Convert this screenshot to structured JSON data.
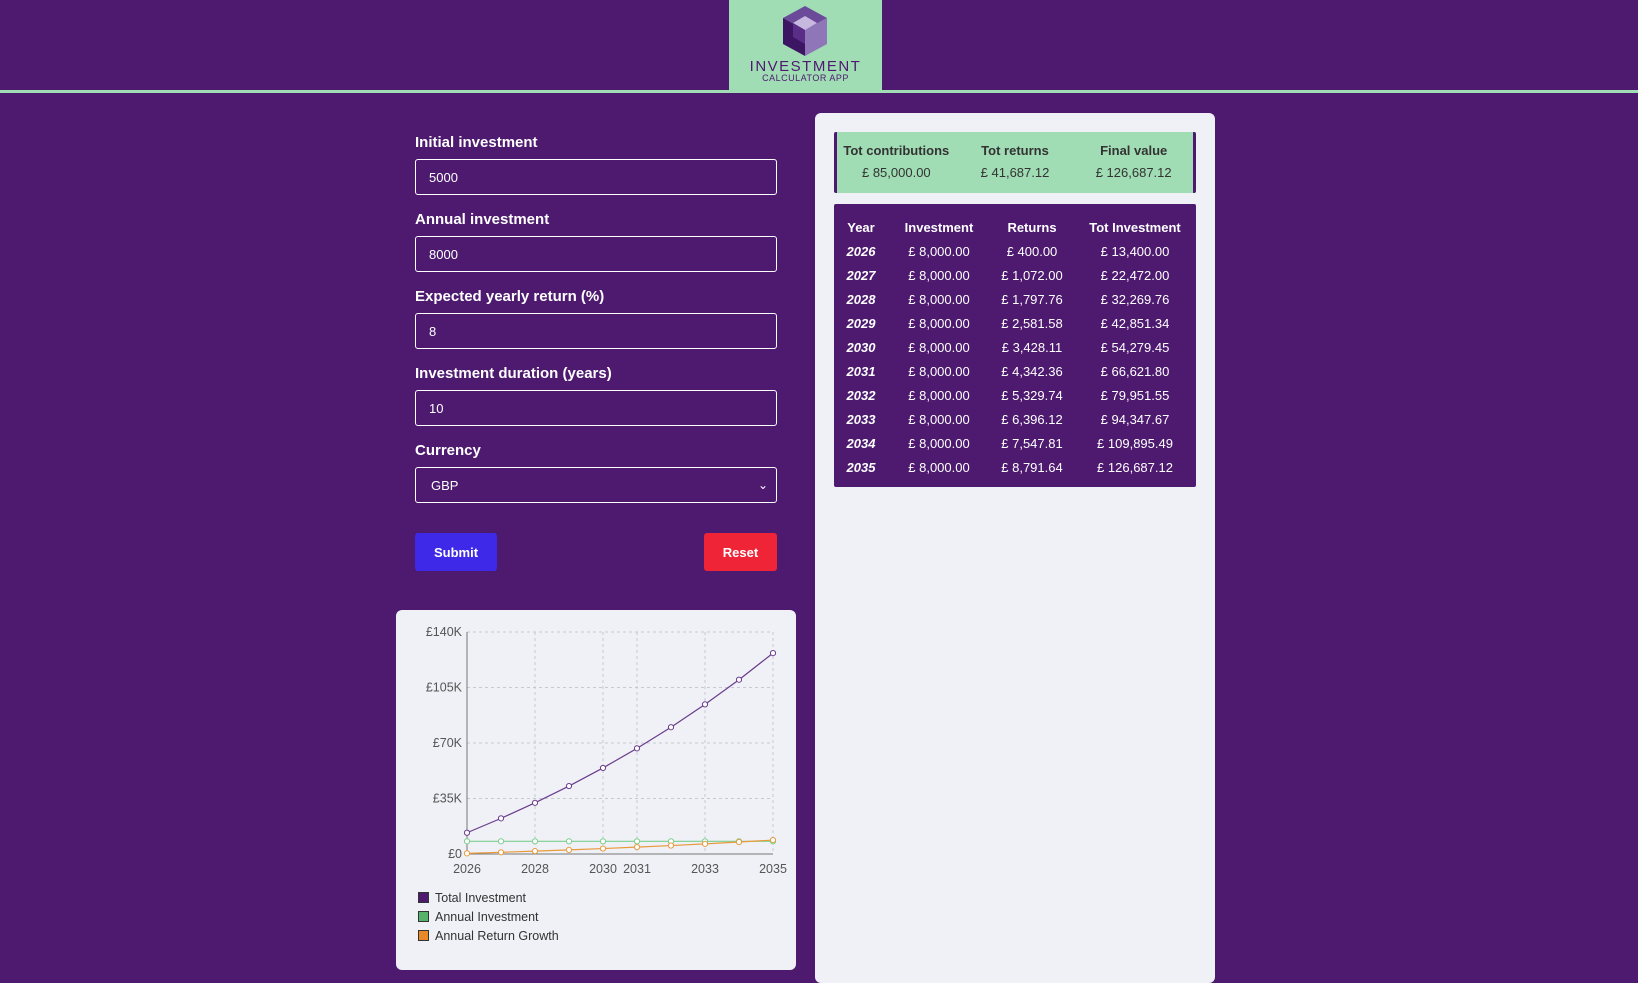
{
  "header": {
    "logo_title": "INVESTMENT",
    "logo_subtitle": "CALCULATOR APP"
  },
  "form": {
    "initial_label": "Initial investment",
    "initial_value": "5000",
    "annual_label": "Annual investment",
    "annual_value": "8000",
    "return_label": "Expected yearly return (%)",
    "return_value": "8",
    "duration_label": "Investment duration (years)",
    "duration_value": "10",
    "currency_label": "Currency",
    "currency_value": "GBP",
    "submit_label": "Submit",
    "reset_label": "Reset"
  },
  "summary": {
    "contrib_label": "Tot contributions",
    "contrib_value": "£ 85,000.00",
    "returns_label": "Tot returns",
    "returns_value": "£ 41,687.12",
    "final_label": "Final value",
    "final_value": "£ 126,687.12"
  },
  "table": {
    "headers": [
      "Year",
      "Investment",
      "Returns",
      "Tot Investment"
    ],
    "rows": [
      [
        "2026",
        "£ 8,000.00",
        "£ 400.00",
        "£ 13,400.00"
      ],
      [
        "2027",
        "£ 8,000.00",
        "£ 1,072.00",
        "£ 22,472.00"
      ],
      [
        "2028",
        "£ 8,000.00",
        "£ 1,797.76",
        "£ 32,269.76"
      ],
      [
        "2029",
        "£ 8,000.00",
        "£ 2,581.58",
        "£ 42,851.34"
      ],
      [
        "2030",
        "£ 8,000.00",
        "£ 3,428.11",
        "£ 54,279.45"
      ],
      [
        "2031",
        "£ 8,000.00",
        "£ 4,342.36",
        "£ 66,621.80"
      ],
      [
        "2032",
        "£ 8,000.00",
        "£ 5,329.74",
        "£ 79,951.55"
      ],
      [
        "2033",
        "£ 8,000.00",
        "£ 6,396.12",
        "£ 94,347.67"
      ],
      [
        "2034",
        "£ 8,000.00",
        "£ 7,547.81",
        "£ 109,895.49"
      ],
      [
        "2035",
        "£ 8,000.00",
        "£ 8,791.64",
        "£ 126,687.12"
      ]
    ]
  },
  "colors": {
    "background": "#4d1a6f",
    "accent": "#a0dcb4",
    "submit": "#3f29e8",
    "reset": "#f02437",
    "card": "#eff1f6"
  },
  "icons": {
    "logo": "cube-logo-icon",
    "select": "chevron-down-icon"
  },
  "chart_data": {
    "type": "line",
    "x": [
      2026,
      2027,
      2028,
      2029,
      2030,
      2031,
      2032,
      2033,
      2034,
      2035
    ],
    "x_tick_labels": [
      "2026",
      "2028",
      "2030",
      "2031",
      "2033",
      "2035"
    ],
    "y_tick_labels": [
      "£0",
      "£35K",
      "£70K",
      "£105K",
      "£140K"
    ],
    "ylim": [
      0,
      140000
    ],
    "grid": true,
    "legend_placement": "bottom-left",
    "series": [
      {
        "name": "Total Investment",
        "color": "#6a3c8c",
        "values": [
          13400,
          22472,
          32269.76,
          42851.34,
          54279.45,
          66621.8,
          79951.55,
          94347.67,
          109895.49,
          126687.12
        ]
      },
      {
        "name": "Annual Investment",
        "color": "#7ccf8e",
        "values": [
          8000,
          8000,
          8000,
          8000,
          8000,
          8000,
          8000,
          8000,
          8000,
          8000
        ]
      },
      {
        "name": "Annual Return Growth",
        "color": "#e89a3c",
        "values": [
          400,
          1072,
          1797.76,
          2581.58,
          3428.11,
          4342.36,
          5329.74,
          6396.12,
          7547.81,
          8791.64
        ]
      }
    ]
  }
}
